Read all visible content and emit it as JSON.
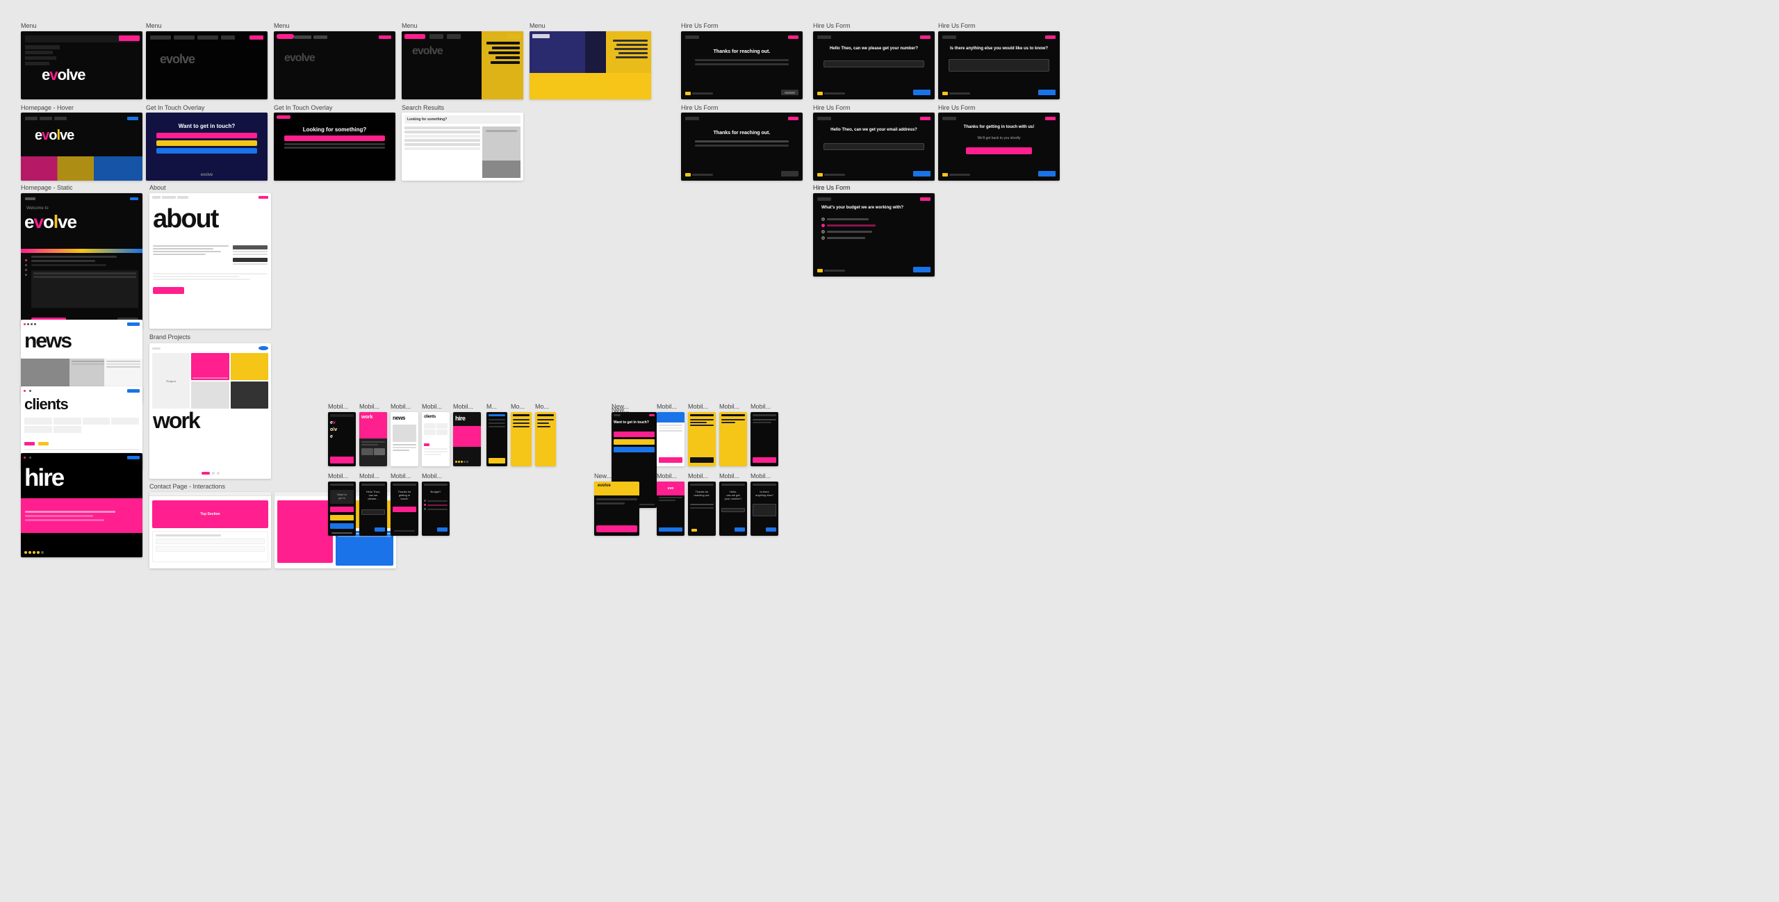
{
  "labels": {
    "menu": "Menu",
    "homepage_hover": "Homepage - Hover",
    "get_in_touch_overlay": "Get In Touch Overlay",
    "search_results": "Search Results",
    "homepage_static": "Homepage - Static",
    "about_label": "About",
    "brand_projects": "Brand Projects",
    "contact_page": "Contact Page - Interactions",
    "hire_us_form": "Hire Us Form",
    "mobile_label": "Mobil...",
    "new_label": "New...",
    "mobile2_label": "Mobil...",
    "evolve": "evolve",
    "work": "work",
    "news": "news",
    "clients": "clients",
    "hire": "hire",
    "about_big": "about",
    "work_big": "work"
  },
  "colors": {
    "pink": "#ff1f8e",
    "yellow": "#f5c518",
    "black": "#0a0a0a",
    "white": "#ffffff",
    "bg": "#e8e8e8",
    "dark_card": "#111111"
  }
}
